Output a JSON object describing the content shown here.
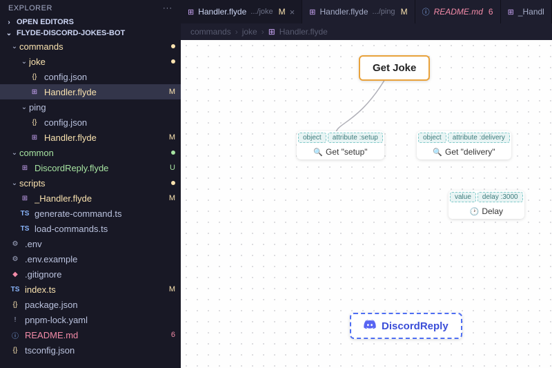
{
  "explorer": {
    "title": "EXPLORER",
    "openEditors": "OPEN EDITORS",
    "project": "FLYDE-DISCORD-JOKES-BOT"
  },
  "tree": [
    {
      "depth": 1,
      "kind": "folder",
      "open": true,
      "label": "commands",
      "status": "modified",
      "circle": true
    },
    {
      "depth": 2,
      "kind": "folder",
      "open": true,
      "label": "joke",
      "status": "modified",
      "circle": true
    },
    {
      "depth": 3,
      "kind": "json",
      "label": "config.json"
    },
    {
      "depth": 3,
      "kind": "flyde",
      "label": "Handler.flyde",
      "status": "modified",
      "badge": "M",
      "active": true
    },
    {
      "depth": 2,
      "kind": "folder",
      "open": true,
      "label": "ping"
    },
    {
      "depth": 3,
      "kind": "json",
      "label": "config.json"
    },
    {
      "depth": 3,
      "kind": "flyde",
      "label": "Handler.flyde",
      "status": "modified",
      "badge": "M"
    },
    {
      "depth": 1,
      "kind": "folder",
      "open": true,
      "label": "common",
      "status": "untracked",
      "circle": true
    },
    {
      "depth": 2,
      "kind": "flyde",
      "label": "DiscordReply.flyde",
      "status": "untracked",
      "badge": "U"
    },
    {
      "depth": 1,
      "kind": "folder",
      "open": true,
      "label": "scripts",
      "status": "modified",
      "circle": true
    },
    {
      "depth": 2,
      "kind": "flyde",
      "label": "_Handler.flyde",
      "status": "modified",
      "badge": "M"
    },
    {
      "depth": 2,
      "kind": "ts",
      "label": "generate-command.ts"
    },
    {
      "depth": 2,
      "kind": "ts",
      "label": "load-commands.ts"
    },
    {
      "depth": 1,
      "kind": "env",
      "label": ".env"
    },
    {
      "depth": 1,
      "kind": "env",
      "label": ".env.example"
    },
    {
      "depth": 1,
      "kind": "git",
      "label": ".gitignore"
    },
    {
      "depth": 1,
      "kind": "ts",
      "label": "index.ts",
      "status": "modified",
      "badge": "M"
    },
    {
      "depth": 1,
      "kind": "json",
      "label": "package.json"
    },
    {
      "depth": 1,
      "kind": "yaml",
      "label": "pnpm-lock.yaml"
    },
    {
      "depth": 1,
      "kind": "readme",
      "label": "README.md",
      "status": "deleted",
      "badge": "6"
    },
    {
      "depth": 1,
      "kind": "json",
      "label": "tsconfig.json"
    }
  ],
  "tabs": [
    {
      "icon": "flyde",
      "name": "Handler.flyde",
      "path": ".../joke",
      "status": "M",
      "class": "modified",
      "active": true,
      "closable": true
    },
    {
      "icon": "flyde",
      "name": "Handler.flyde",
      "path": ".../ping",
      "status": "M",
      "class": "modified"
    },
    {
      "icon": "readme",
      "name": "README.md",
      "status": "6",
      "class": "deleted"
    },
    {
      "icon": "flyde",
      "name": "_Handl"
    }
  ],
  "breadcrumb": {
    "seg1": "commands",
    "seg2": "joke",
    "seg3": "Handler.flyde"
  },
  "nodes": {
    "getJoke": {
      "label": "Get Joke"
    },
    "getSetup": {
      "pin1": "object",
      "pin2": "attribute :setup",
      "body": "Get \"setup\"",
      "glyph": "🔍"
    },
    "getDelivery": {
      "pin1": "object",
      "pin2": "attribute :delivery",
      "body": "Get \"delivery\"",
      "glyph": "🔍"
    },
    "delay": {
      "pin1": "value",
      "pin2": "delay :3000",
      "body": "Delay",
      "glyph": "🕑"
    },
    "discordReply": {
      "label": "DiscordReply"
    }
  }
}
